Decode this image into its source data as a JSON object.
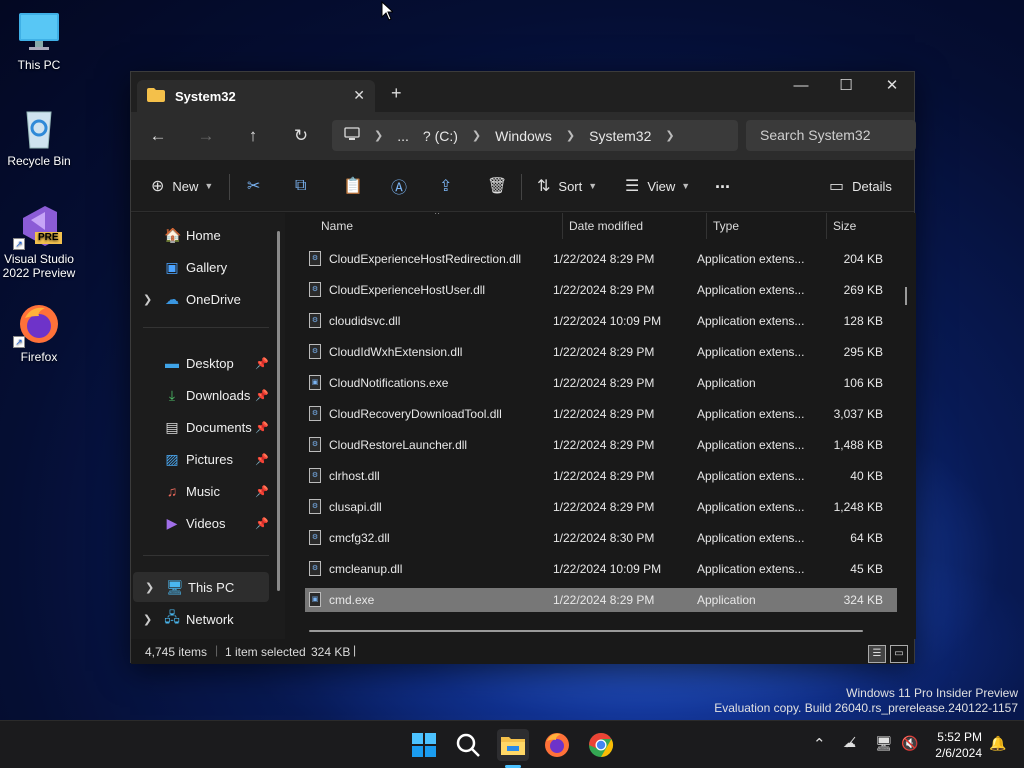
{
  "desktop": {
    "icons": [
      {
        "label": "This PC"
      },
      {
        "label": "Recycle Bin"
      },
      {
        "label": "Visual Studio 2022 Preview",
        "badge": "PRE"
      },
      {
        "label": "Firefox"
      }
    ]
  },
  "window": {
    "tab_title": "System32",
    "address": {
      "crumbs": [
        "...",
        "? (C:)",
        "Windows",
        "System32"
      ]
    },
    "search_placeholder": "Search System32",
    "toolbar": {
      "new": "New",
      "sort": "Sort",
      "view": "View",
      "more": "...",
      "details": "Details"
    },
    "nav": {
      "home": "Home",
      "gallery": "Gallery",
      "onedrive": "OneDrive",
      "desktop": "Desktop",
      "downloads": "Downloads",
      "documents": "Documents",
      "pictures": "Pictures",
      "music": "Music",
      "videos": "Videos",
      "thispc": "This PC",
      "network": "Network"
    },
    "columns": {
      "name": "Name",
      "date": "Date modified",
      "type": "Type",
      "size": "Size"
    },
    "files": [
      {
        "name": "CloudExperienceHostRedirection.dll",
        "date": "1/22/2024 8:29 PM",
        "type": "Application extens...",
        "size": "204 KB"
      },
      {
        "name": "CloudExperienceHostUser.dll",
        "date": "1/22/2024 8:29 PM",
        "type": "Application extens...",
        "size": "269 KB"
      },
      {
        "name": "cloudidsvc.dll",
        "date": "1/22/2024 10:09 PM",
        "type": "Application extens...",
        "size": "128 KB"
      },
      {
        "name": "CloudIdWxhExtension.dll",
        "date": "1/22/2024 8:29 PM",
        "type": "Application extens...",
        "size": "295 KB"
      },
      {
        "name": "CloudNotifications.exe",
        "date": "1/22/2024 8:29 PM",
        "type": "Application",
        "size": "106 KB"
      },
      {
        "name": "CloudRecoveryDownloadTool.dll",
        "date": "1/22/2024 8:29 PM",
        "type": "Application extens...",
        "size": "3,037 KB"
      },
      {
        "name": "CloudRestoreLauncher.dll",
        "date": "1/22/2024 8:29 PM",
        "type": "Application extens...",
        "size": "1,488 KB"
      },
      {
        "name": "clrhost.dll",
        "date": "1/22/2024 8:29 PM",
        "type": "Application extens...",
        "size": "40 KB"
      },
      {
        "name": "clusapi.dll",
        "date": "1/22/2024 8:29 PM",
        "type": "Application extens...",
        "size": "1,248 KB"
      },
      {
        "name": "cmcfg32.dll",
        "date": "1/22/2024 8:30 PM",
        "type": "Application extens...",
        "size": "64 KB"
      },
      {
        "name": "cmcleanup.dll",
        "date": "1/22/2024 10:09 PM",
        "type": "Application extens...",
        "size": "45 KB"
      },
      {
        "name": "cmd.exe",
        "date": "1/22/2024 8:29 PM",
        "type": "Application",
        "size": "324 KB"
      }
    ],
    "status": {
      "items": "4,745 items",
      "selected": "1 item selected",
      "selected_size": "324 KB"
    }
  },
  "watermark": {
    "line1": "Windows 11 Pro Insider Preview",
    "line2": "Evaluation copy. Build 26040.rs_prerelease.240122-1157"
  },
  "taskbar": {
    "time": "5:52 PM",
    "date": "2/6/2024"
  },
  "colors": {
    "accent": "#0078d4",
    "folder": "#f4c04a",
    "selection": "#777777"
  }
}
